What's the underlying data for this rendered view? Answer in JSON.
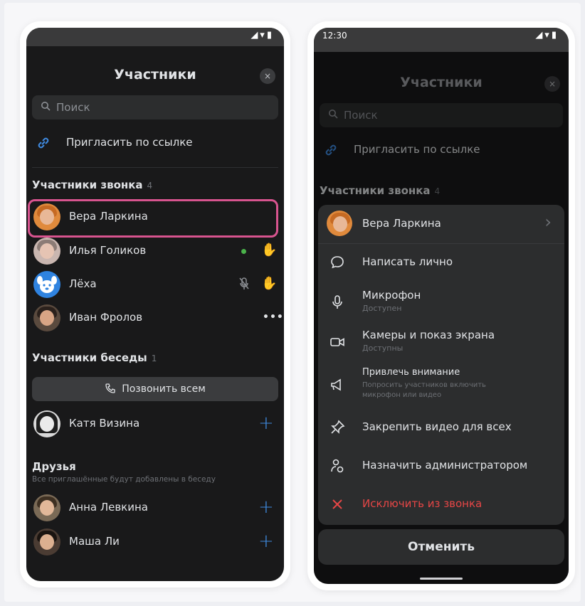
{
  "left_phone": {
    "title": "Участники",
    "close_icon": "×",
    "search_placeholder": "Поиск",
    "invite_label": "Пригласить по ссылке",
    "call_section": {
      "title": "Участники звонка",
      "count": "4"
    },
    "call_participants": [
      {
        "name": "Вера Ларкина"
      },
      {
        "name": "Илья Голиков"
      },
      {
        "name": "Лёха"
      },
      {
        "name": "Иван Фролов"
      }
    ],
    "chat_section": {
      "title": "Участники беседы",
      "count": "1"
    },
    "call_all_label": "Позвонить всем",
    "chat_participants": [
      {
        "name": "Катя Визина"
      }
    ],
    "friends_section": {
      "title": "Друзья",
      "note": "Все приглашённые будут добавлены в беседу"
    },
    "friends": [
      {
        "name": "Анна Левкина"
      },
      {
        "name": "Маша Ли"
      }
    ],
    "accent_color": "#3f8ae0",
    "highlight_color": "#d8548f"
  },
  "right_phone": {
    "status_time": "12:30",
    "title": "Участники",
    "close_icon": "×",
    "search_placeholder": "Поиск",
    "invite_label": "Пригласить по ссылке",
    "call_section": {
      "title": "Участники звонка",
      "count": "4"
    },
    "sheet": {
      "participant_name": "Вера Ларкина",
      "chevron": "›",
      "items": [
        {
          "label": "Написать лично"
        },
        {
          "label": "Микрофон",
          "sub": "Доступен"
        },
        {
          "label": "Камеры и показ экрана",
          "sub": "Доступны"
        },
        {
          "label": "Привлечь внимание",
          "sub": "Попросить участников включить микрофон или видео"
        },
        {
          "label": "Закрепить видео для всех"
        },
        {
          "label": "Назначить администратором"
        },
        {
          "label": "Исключить из звонка"
        }
      ]
    },
    "cancel_label": "Отменить",
    "danger_color": "#e64646"
  }
}
